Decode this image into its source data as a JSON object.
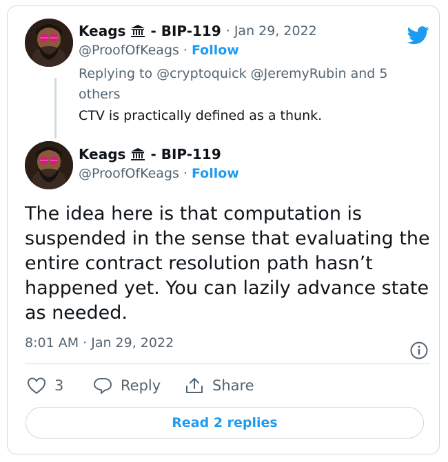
{
  "parent_tweet": {
    "author_name": "Keags",
    "badge_icon": "bank-building-icon",
    "author_suffix": "- BIP-119",
    "date": "· Jan 29, 2022",
    "handle": "@ProofOfKeags",
    "separator": "·",
    "follow_label": "Follow",
    "replying_line1": "Replying to @cryptoquick @JeremyRubin and 5",
    "replying_line2": "others",
    "text": "CTV is practically defined as a thunk."
  },
  "main_tweet": {
    "author_name": "Keags",
    "badge_icon": "bank-building-icon",
    "author_suffix": "- BIP-119",
    "handle": "@ProofOfKeags",
    "separator": "·",
    "follow_label": "Follow",
    "text_lines": [
      "The idea here is that computation is",
      "suspended in the sense that evaluating the",
      "entire contract resolution path hasn’t",
      "happened yet. You can lazily advance state",
      "as needed."
    ],
    "timestamp": "8:01 AM · Jan 29, 2022"
  },
  "actions": {
    "like_count": "3",
    "reply_label": "Reply",
    "share_label": "Share"
  },
  "read_replies_label": "Read 2 replies",
  "colors": {
    "accent": "#1d9bf0",
    "muted": "#536471",
    "border": "#cfd9de",
    "text": "#0f1419"
  }
}
